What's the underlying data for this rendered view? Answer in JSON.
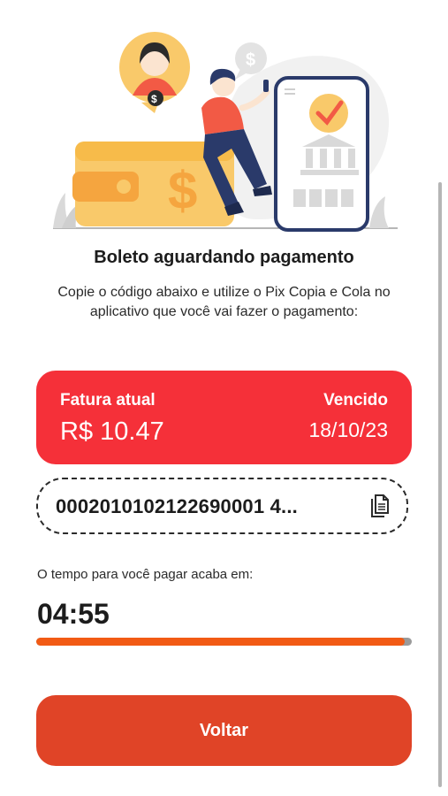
{
  "content": {
    "title": "Boleto aguardando pagamento",
    "subtitle": "Copie o código abaixo e utilize o Pix Copia e Cola no aplicativo que você vai fazer o pagamento:"
  },
  "invoice": {
    "label": "Fatura atual",
    "amount": "R$ 10.47",
    "due_label": "Vencido",
    "due_date": "18/10/23"
  },
  "pix": {
    "code": "0002010102122690001 4...",
    "copy_icon": "copy-document-icon"
  },
  "timer": {
    "label": "O tempo para você pagar acaba em:",
    "value": "04:55",
    "progress_fraction": 0.98
  },
  "actions": {
    "back_label": "Voltar"
  },
  "colors": {
    "invoice_card": "#f53039",
    "button": "#e04427",
    "progress": "#f25a14"
  }
}
